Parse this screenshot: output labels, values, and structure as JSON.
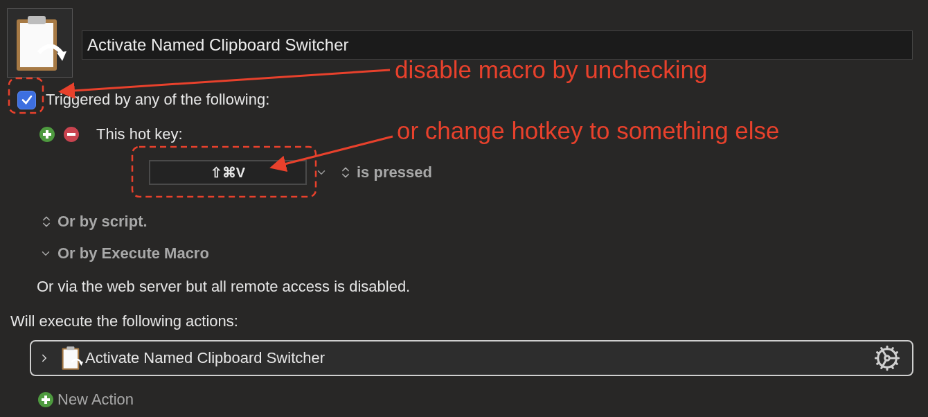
{
  "macro": {
    "name": "Activate Named Clipboard Switcher"
  },
  "trigger": {
    "enabled": true,
    "label": "Triggered by any of the following:"
  },
  "triggers": [
    {
      "kind": "hotkey",
      "label": "This hot key:",
      "keys": "⇧⌘V",
      "condition": "is pressed"
    }
  ],
  "sections": [
    {
      "kind": "popup",
      "label": "Or by script."
    },
    {
      "kind": "disclosure",
      "label": "Or by Execute Macro"
    }
  ],
  "note": "Or via the web server but all remote access is disabled.",
  "actions_heading": "Will execute the following actions:",
  "actions": [
    {
      "name": "Activate Named Clipboard Switcher",
      "expanded": false
    }
  ],
  "new_action": "New Action",
  "annotations": [
    {
      "text": "disable macro by unchecking"
    },
    {
      "text": "or change hotkey to something else"
    }
  ]
}
